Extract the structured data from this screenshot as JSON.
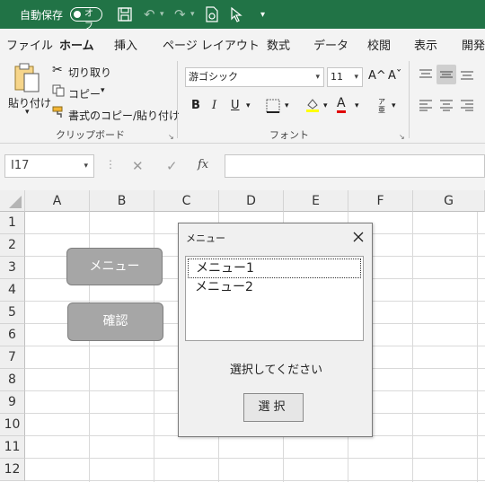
{
  "titlebar": {
    "autosave_label": "自動保存",
    "autosave_state": "オフ",
    "qa_icons": [
      "save-icon",
      "undo-icon",
      "redo-icon",
      "print-preview-icon",
      "pointer-icon",
      "customize-icon"
    ]
  },
  "tabs": [
    "ファイル",
    "ホーム",
    "挿入",
    "ページ レイアウト",
    "数式",
    "データ",
    "校閲",
    "表示",
    "開発"
  ],
  "active_tab": "ホーム",
  "ribbon": {
    "clipboard": {
      "paste_label": "貼り付け",
      "cut_label": "切り取り",
      "copy_label": "コピー",
      "format_painter_label": "書式のコピー/貼り付け",
      "group_label": "クリップボード"
    },
    "font": {
      "font_name": "游ゴシック",
      "font_size": "11",
      "grow_label": "A^",
      "shrink_label": "Aˇ",
      "bold": "B",
      "italic": "I",
      "underline": "U",
      "font_color_label": "A",
      "phonetic_label": "ア亜",
      "group_label": "フォント"
    }
  },
  "formula_bar": {
    "name_box": "I17",
    "cancel": "✕",
    "enter": "✓",
    "fx": "fx",
    "value": ""
  },
  "sheet": {
    "columns": [
      "A",
      "B",
      "C",
      "D",
      "E",
      "F",
      "G"
    ],
    "rows": [
      "1",
      "2",
      "3",
      "4",
      "5",
      "6",
      "7",
      "8",
      "9",
      "10",
      "11",
      "12"
    ],
    "buttons": {
      "menu": "メニュー",
      "confirm": "確認"
    }
  },
  "dialog": {
    "title": "メニュー",
    "items": [
      "メニュー1",
      "メニュー2"
    ],
    "selected_index": 0,
    "message": "選択してください",
    "select_button": "選択"
  },
  "colors": {
    "excel_green": "#217346",
    "ribbon_bg": "#f3f3f3",
    "sheet_button": "#a6a6a6"
  }
}
